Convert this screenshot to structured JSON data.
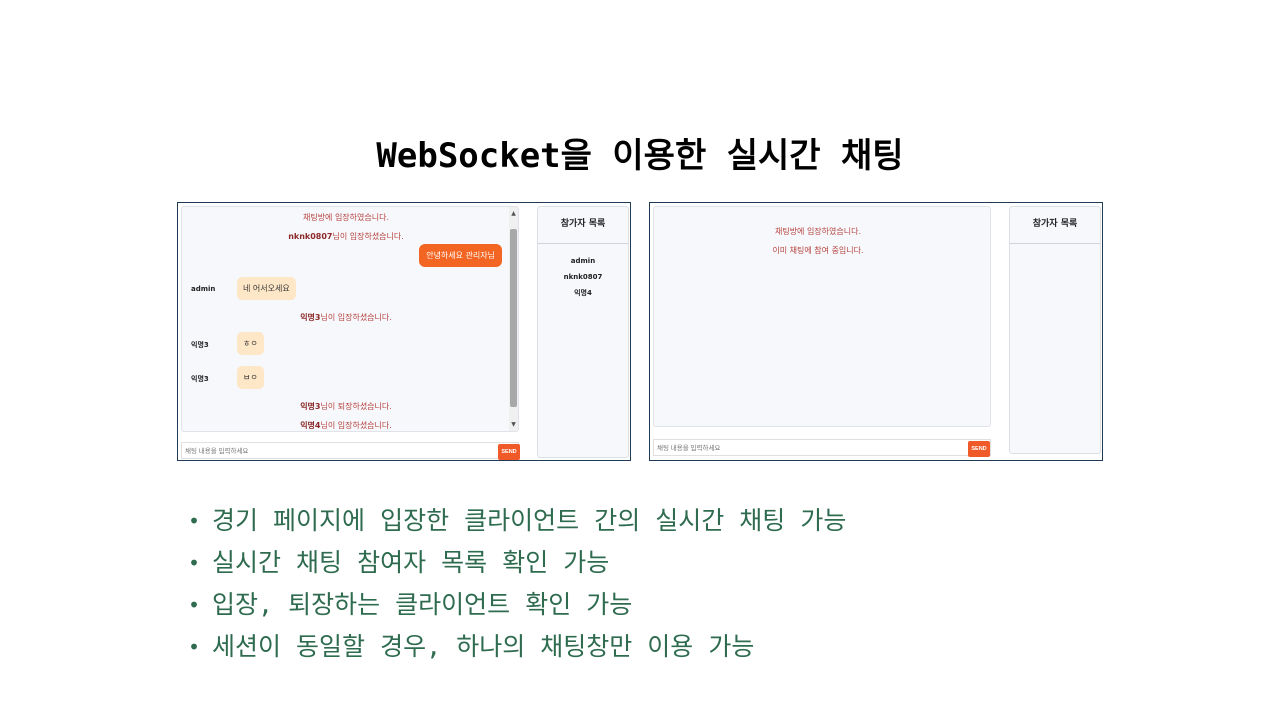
{
  "title": "WebSocket을 이용한 실시간 채팅",
  "left_window": {
    "messages": {
      "sys1": "채팅방에 입장하였습니다.",
      "join_admin_nick": "nknk0807",
      "join_admin_suffix": "님이 입장하셨습니다.",
      "my_message": "안녕하세요 관리자님",
      "admin_nick": "admin",
      "admin_message": "네 어서오세요",
      "join3_nick": "익명3",
      "join3_suffix": "님이 입장하셨습니다.",
      "anon3_nick_a": "익명3",
      "anon3_msg_a": "ㅎㅇ",
      "anon3_nick_b": "익명3",
      "anon3_msg_b": "ㅂㅇ",
      "leave3_nick": "익명3",
      "leave3_suffix": "님이 퇴장하셨습니다.",
      "join4_nick": "익명4",
      "join4_suffix": "님이 입장하셨습니다."
    },
    "input_placeholder": "채팅 내용을 입력하세요",
    "send_label": "SEND",
    "participants_header": "참가자 목록",
    "participants": [
      "admin",
      "nknk0807",
      "익명4"
    ]
  },
  "right_window": {
    "messages": {
      "sys1": "채팅방에 입장하였습니다.",
      "sys2": "이미 채팅에 참여 중입니다."
    },
    "input_placeholder": "채팅 내용을 입력하세요",
    "send_label": "SEND",
    "participants_header": "참가자 목록"
  },
  "bullets": [
    "경기 페이지에 입장한 클라이언트 간의 실시간 채팅 가능",
    "실시간 채팅 참여자 목록 확인 가능",
    "입장, 퇴장하는 클라이언트 확인 가능",
    "세션이 동일할 경우, 하나의 채팅창만 이용 가능"
  ],
  "bullet_symbol": "•",
  "colors": {
    "accent": "#f26522",
    "bullet_text": "#2e6b4f",
    "system_message": "#b5413b"
  }
}
